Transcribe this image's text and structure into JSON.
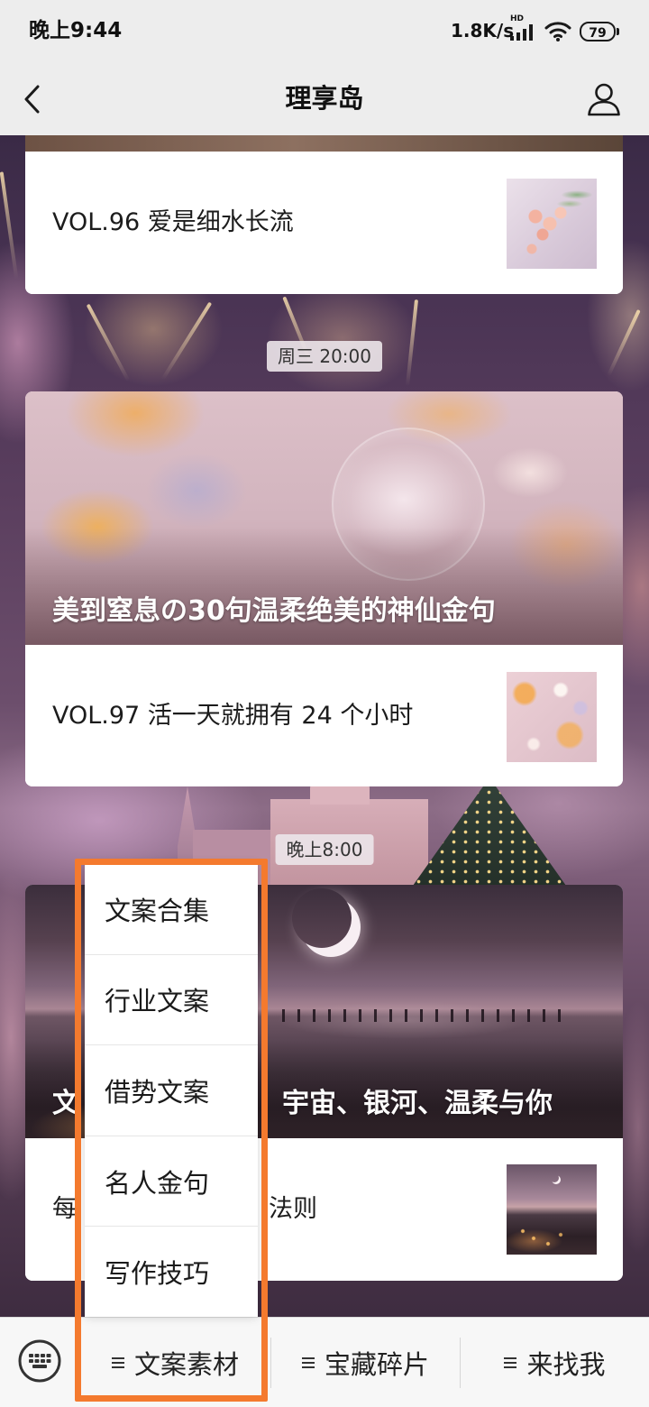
{
  "status_bar": {
    "time": "晚上9:44",
    "net_speed": "1.8K/s",
    "network_badge": "HD",
    "battery": "79"
  },
  "nav": {
    "title": "理享岛",
    "back_icon": "chevron-left-icon",
    "profile_icon": "person-icon"
  },
  "feed": {
    "cards": [
      {
        "title": "VOL.96 爱是细水长流"
      },
      {
        "cover_title": "美到窒息の30句温柔绝美的神仙金句",
        "title": "VOL.97 活一天就拥有 24 个小时"
      },
      {
        "cover_title_parts": [
          "文",
          "宇宙、银河、温柔与你"
        ],
        "title_parts": [
          "每",
          "法则"
        ]
      }
    ],
    "timestamps": [
      "周三 20:00",
      "晚上8:00"
    ]
  },
  "popup_menu": {
    "items": [
      "文案合集",
      "行业文案",
      "借势文案",
      "名人金句",
      "写作技巧"
    ]
  },
  "bottom_menu": {
    "keyboard_icon": "keyboard-icon",
    "tabs": [
      {
        "icon": "menu-icon",
        "label": "文案素材"
      },
      {
        "icon": "menu-icon",
        "label": "宝藏碎片"
      },
      {
        "icon": "menu-icon",
        "label": "来找我"
      }
    ]
  },
  "theme": {
    "highlight_color": "#f47a2e",
    "header_bg": "#ededed"
  }
}
